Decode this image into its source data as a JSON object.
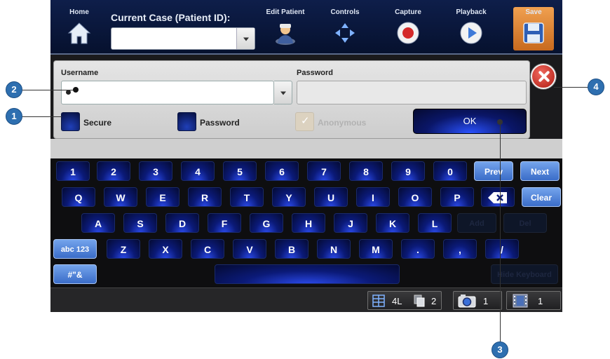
{
  "toolbar": {
    "home_label": "Home",
    "case_title": "Current Case (Patient ID):",
    "case_value": "",
    "edit_patient_label": "Edit Patient",
    "controls_label": "Controls",
    "capture_label": "Capture",
    "playback_label": "Playback",
    "save_label": "Save"
  },
  "login": {
    "username_label": "Username",
    "username_value": "",
    "password_label": "Password",
    "password_value": "",
    "secure_label": "Secure",
    "password_check_label": "Password",
    "anonymous_label": "Anonymous",
    "anonymous_checked": true,
    "ok_label": "OK"
  },
  "keyboard": {
    "row1": [
      "1",
      "2",
      "3",
      "4",
      "5",
      "6",
      "7",
      "8",
      "9",
      "0"
    ],
    "prev_label": "Prev",
    "next_label": "Next",
    "row2": [
      "Q",
      "W",
      "E",
      "R",
      "T",
      "Y",
      "U",
      "I",
      "O",
      "P"
    ],
    "clear_label": "Clear",
    "row3": [
      "A",
      "S",
      "D",
      "F",
      "G",
      "H",
      "J",
      "K",
      "L"
    ],
    "add_label": "Add",
    "del_label": "Del",
    "abc_label": "abc 123",
    "row4": [
      "Z",
      "X",
      "C",
      "V",
      "B",
      "N",
      "M",
      ".",
      ",",
      "/"
    ],
    "symbols_label": "#\"&",
    "hide_label": "Hide Keyboard"
  },
  "status": {
    "layout_value": "4L",
    "pages_value": "2",
    "camera_value": "1",
    "film_value": "1"
  },
  "callouts": [
    "1",
    "2",
    "3",
    "4"
  ],
  "colors": {
    "toolbar_bg": "#0e1e4a",
    "save_accent": "#e08a3a",
    "key_blue": "#0b1a78",
    "callout_blue": "#2e6fb0",
    "close_red": "#d8362a"
  }
}
